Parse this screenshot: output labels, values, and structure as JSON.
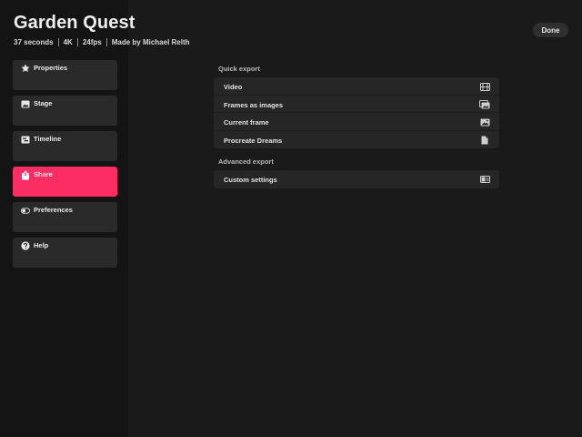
{
  "project": {
    "title": "Garden Quest",
    "duration": "37 seconds",
    "resolution": "4K",
    "fps": "24fps",
    "author": "Made by Michael Relth"
  },
  "header": {
    "done_label": "Done"
  },
  "sidebar": {
    "items": [
      {
        "label": "Properties",
        "icon": "star-icon",
        "active": false
      },
      {
        "label": "Stage",
        "icon": "image-icon",
        "active": false
      },
      {
        "label": "Timeline",
        "icon": "timeline-icon",
        "active": false
      },
      {
        "label": "Share",
        "icon": "share-icon",
        "active": true
      },
      {
        "label": "Preferences",
        "icon": "toggle-icon",
        "active": false
      },
      {
        "label": "Help",
        "icon": "help-icon",
        "active": false
      }
    ]
  },
  "quick_export": {
    "title": "Quick export",
    "items": [
      {
        "label": "Video",
        "icon": "film-icon"
      },
      {
        "label": "Frames as images",
        "icon": "images-icon"
      },
      {
        "label": "Current frame",
        "icon": "image-icon"
      },
      {
        "label": "Procreate Dreams",
        "icon": "document-icon"
      }
    ]
  },
  "advanced_export": {
    "title": "Advanced export",
    "items": [
      {
        "label": "Custom settings",
        "icon": "settings-panel-icon"
      }
    ]
  },
  "colors": {
    "accent": "#fb2d62",
    "background": "#181818",
    "card": "#2a2a2a"
  }
}
